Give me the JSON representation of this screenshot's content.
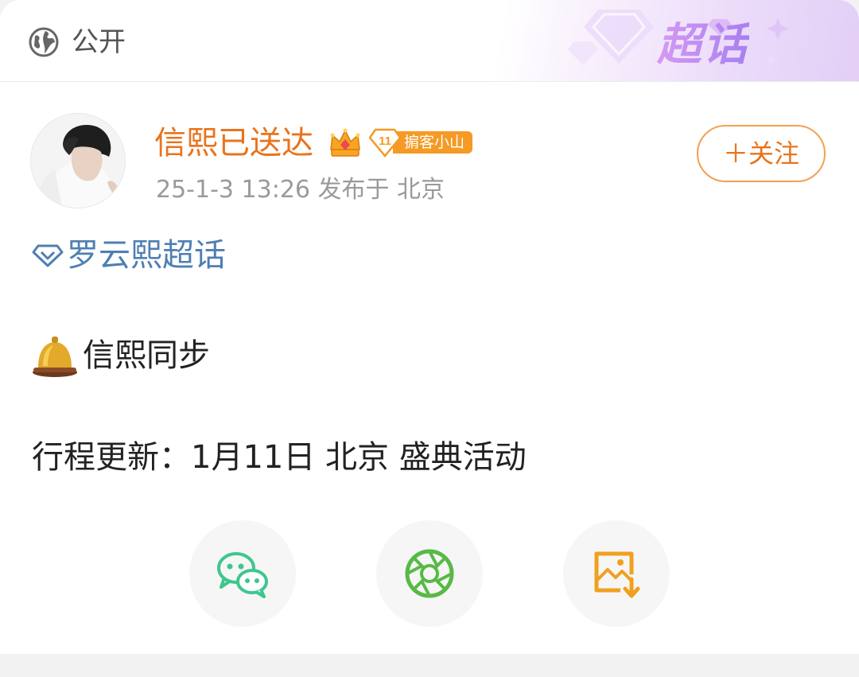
{
  "header": {
    "visibility_icon": "globe-icon",
    "visibility_label": "公开",
    "supertopic_brand": "超话"
  },
  "post": {
    "author": {
      "name": "信熙已送达",
      "crown_icon": "crown-icon",
      "fan_level": "11",
      "fan_badge": "掮客小山"
    },
    "meta": "25-1-3 13:26  发布于 北京",
    "follow_label": "＋关注",
    "topic_icon": "diamond-icon",
    "topic": "罗云熙超话",
    "line1_icon": "bell-icon",
    "line1": "信熙同步",
    "line2": "行程更新：1月11日  北京  盛典活动"
  },
  "share": [
    {
      "name": "wechat",
      "icon": "wechat-icon"
    },
    {
      "name": "moments",
      "icon": "moments-icon"
    },
    {
      "name": "save-image",
      "icon": "save-image-icon"
    }
  ],
  "colors": {
    "username": "#e8741d",
    "topic": "#4f7fb3",
    "badge": "#f59a24",
    "wechat": "#3ec68e",
    "moments": "#58b946",
    "save": "#f0a020"
  }
}
